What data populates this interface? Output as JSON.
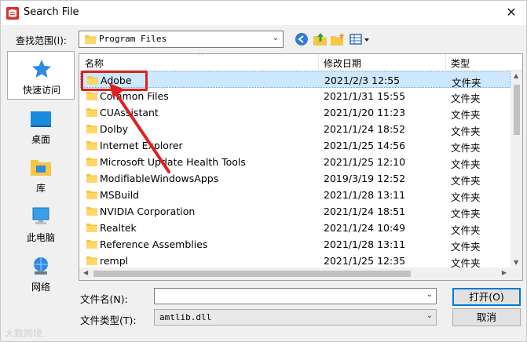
{
  "window": {
    "title": "Search File",
    "close_glyph": "✕"
  },
  "lookin": {
    "label": "查找范围(I):",
    "value": "Program Files"
  },
  "toolbar": {
    "icons": [
      "back-icon",
      "up-folder-icon",
      "new-folder-icon",
      "view-menu-icon"
    ]
  },
  "places": [
    {
      "label": "快速访问",
      "icon": "star-icon"
    },
    {
      "label": "桌面",
      "icon": "desktop-icon"
    },
    {
      "label": "库",
      "icon": "library-icon"
    },
    {
      "label": "此电脑",
      "icon": "computer-icon"
    },
    {
      "label": "网络",
      "icon": "network-icon"
    }
  ],
  "columns": {
    "name": "名称",
    "date": "修改日期",
    "type": "类型"
  },
  "files": [
    {
      "name": "Adobe",
      "date": "2021/2/3 12:55",
      "type": "文件夹",
      "selected": true
    },
    {
      "name": "Common Files",
      "date": "2021/1/31 15:55",
      "type": "文件夹"
    },
    {
      "name": "CUAssistant",
      "date": "2021/1/20 11:23",
      "type": "文件夹"
    },
    {
      "name": "Dolby",
      "date": "2021/1/24 18:52",
      "type": "文件夹"
    },
    {
      "name": "Internet Explorer",
      "date": "2021/1/25 14:56",
      "type": "文件夹"
    },
    {
      "name": "Microsoft Update Health Tools",
      "date": "2021/1/25 12:10",
      "type": "文件夹"
    },
    {
      "name": "ModifiableWindowsApps",
      "date": "2019/3/19 12:52",
      "type": "文件夹"
    },
    {
      "name": "MSBuild",
      "date": "2021/1/28 13:11",
      "type": "文件夹"
    },
    {
      "name": "NVIDIA Corporation",
      "date": "2021/1/24 18:51",
      "type": "文件夹"
    },
    {
      "name": "Realtek",
      "date": "2021/1/24 10:49",
      "type": "文件夹"
    },
    {
      "name": "Reference Assemblies",
      "date": "2021/1/28 13:11",
      "type": "文件夹"
    },
    {
      "name": "rempl",
      "date": "2021/1/25 12:35",
      "type": "文件夹"
    }
  ],
  "filename": {
    "label": "文件名(N):",
    "value": ""
  },
  "filetype": {
    "label": "文件类型(T):",
    "value": "amtlib.dll"
  },
  "buttons": {
    "open": "打开(O)",
    "cancel": "取消"
  },
  "watermark": "大数跨境",
  "colors": {
    "accent": "#0078d7",
    "selection": "#cce8ff",
    "annotation": "#e02020",
    "folder": "#f5c642"
  }
}
